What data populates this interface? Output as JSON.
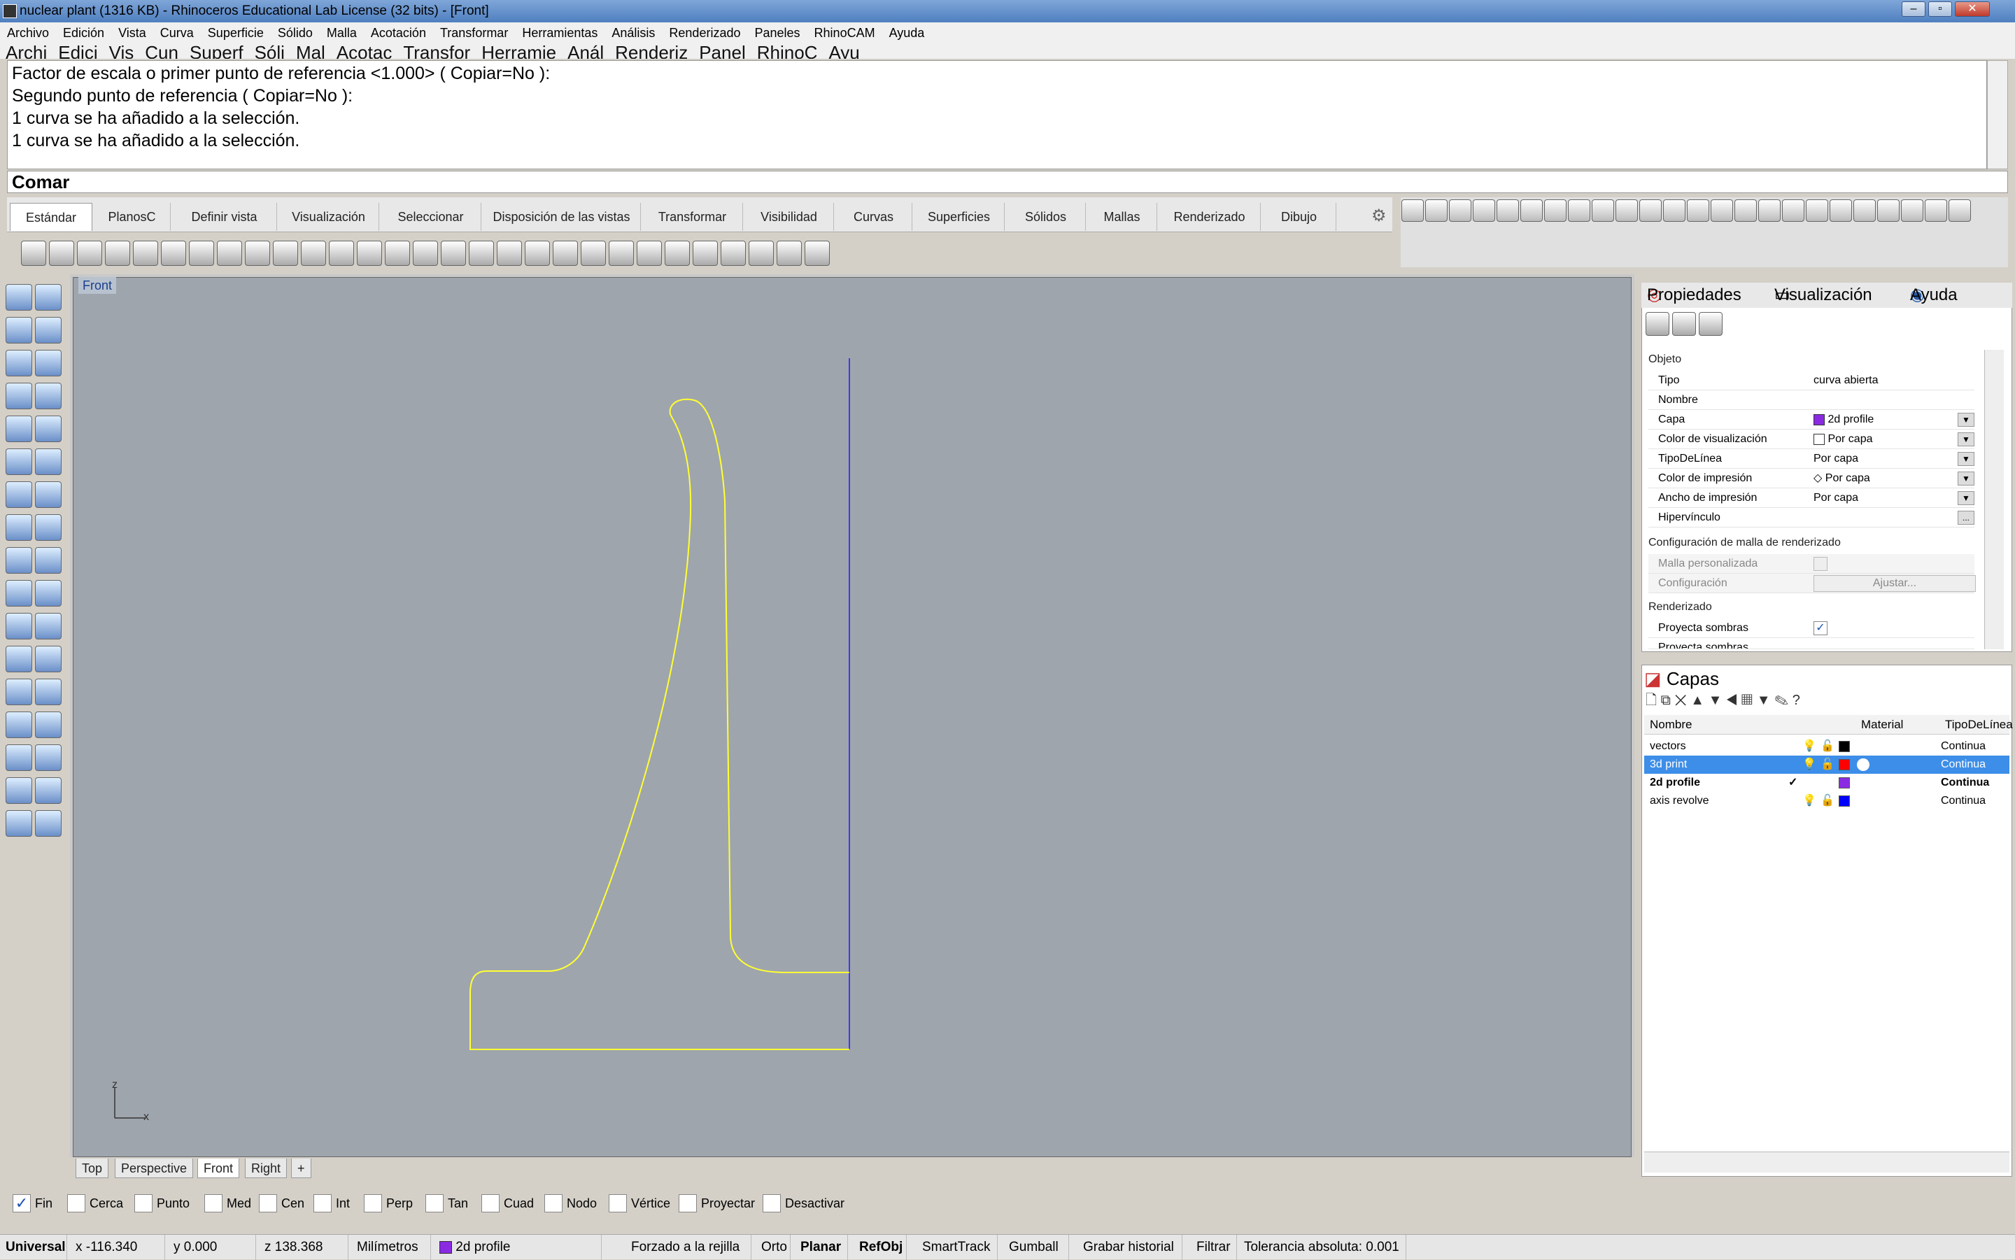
{
  "window": {
    "title": "nuclear plant (1316 KB) - Rhinoceros Educational Lab License (32 bits) - [Front]",
    "btn_min": "–",
    "btn_max": "▫",
    "btn_close": "✕"
  },
  "menu": [
    "Archivo",
    "Edición",
    "Vista",
    "Curva",
    "Superficie",
    "Sólido",
    "Malla",
    "Acotación",
    "Transformar",
    "Herramientas",
    "Análisis",
    "Renderizado",
    "Paneles",
    "RhinoCAM",
    "Ayuda"
  ],
  "menu_truncated": [
    "Archi",
    "Edici",
    "Vis",
    "Cun",
    "Superf",
    "Sóli",
    "Mal",
    "Acotac",
    "Transfor",
    "Herramie",
    "Anál",
    "Renderiz",
    "Panel",
    "RhinoC",
    "Ayu"
  ],
  "command": {
    "history": [
      "Factor de escala o primer punto de referencia <1.000> ( Copiar=No ):",
      "Segundo punto de referencia ( Copiar=No ):",
      "1 curva se ha añadido a la selección.",
      "1 curva se ha añadido a la selección."
    ],
    "prompt": "Comar"
  },
  "toolbar_tabs": [
    "Estándar",
    "PlanosC",
    "Definir vista",
    "Visualización",
    "Seleccionar",
    "Disposición de las vistas",
    "Transformar",
    "Visibilidad",
    "Curvas",
    "Superficies",
    "Sólidos",
    "Mallas",
    "Renderizado",
    "Dibujo"
  ],
  "viewport": {
    "name": "Front",
    "axis_z": "z",
    "axis_x": "x",
    "curve_color": "#ffff33",
    "axis_color": "#3a3aff"
  },
  "viewport_tabs": [
    "Top",
    "Perspective",
    "Front",
    "Right"
  ],
  "viewport_tab_add": "+",
  "osnaps": [
    {
      "label": "Fin",
      "checked": "✓"
    },
    {
      "label": "Cerca",
      "checked": ""
    },
    {
      "label": "Punto",
      "checked": ""
    },
    {
      "label": "Med",
      "checked": ""
    },
    {
      "label": "Cen",
      "checked": ""
    },
    {
      "label": "Int",
      "checked": ""
    },
    {
      "label": "Perp",
      "checked": ""
    },
    {
      "label": "Tan",
      "checked": ""
    },
    {
      "label": "Cuad",
      "checked": ""
    },
    {
      "label": "Nodo",
      "checked": ""
    },
    {
      "label": "Vértice",
      "checked": ""
    },
    {
      "label": "Proyectar",
      "checked": ""
    },
    {
      "label": "Desactivar",
      "checked": ""
    }
  ],
  "status": {
    "cplane": "Universal",
    "x": "x -116.340",
    "y": "y 0.000",
    "z": "z 138.368",
    "units": "Milímetros",
    "layer": "2d profile",
    "grid_snap": "Forzado a la rejilla",
    "ortho": "Orto",
    "planar": "Planar",
    "refobj": "RefObj",
    "smarttrack": "SmartTrack",
    "gumball": "Gumball",
    "history": "Grabar historial",
    "filter": "Filtrar",
    "tolerance": "Tolerancia absoluta: 0.001"
  },
  "properties": {
    "tabs": [
      "Propiedades",
      "Visualización",
      "Ayuda"
    ],
    "section_object": "Objeto",
    "rows": [
      {
        "k": "Tipo",
        "v": "curva abierta"
      },
      {
        "k": "Nombre",
        "v": ""
      },
      {
        "k": "Capa",
        "v": "2d profile"
      },
      {
        "k": "Color de visualización",
        "v": "Por capa"
      },
      {
        "k": "TipoDeLínea",
        "v": "Por capa"
      },
      {
        "k": "Color de impresión",
        "v": "Por capa"
      },
      {
        "k": "Ancho de impresión",
        "v": "Por capa"
      },
      {
        "k": "Hipervínculo",
        "v": ""
      }
    ],
    "section_mesh": "Configuración de malla de renderizado",
    "mesh_custom": "Malla personalizada",
    "mesh_config": "Configuración",
    "adjust_btn": "Ajustar...",
    "section_render": "Renderizado",
    "cast_shadows": "Proyecta sombras",
    "cast_shadows2": "Proyecta sombras",
    "hyperlink_btn": "...",
    "dropdown_arrow": "▼",
    "check": "✓"
  },
  "layers": {
    "title": "Capas",
    "columns": [
      "Nombre",
      "Material",
      "TipoDeLínea"
    ],
    "rows": [
      {
        "name": "vectors",
        "color": "#000000",
        "linetype": "Continua",
        "current": ""
      },
      {
        "name": "3d print",
        "color": "#ff0000",
        "linetype": "Continua",
        "current": ""
      },
      {
        "name": "2d profile",
        "color": "#8a2be2",
        "linetype": "Continua",
        "current": "✓"
      },
      {
        "name": "axis revolve",
        "color": "#0000ff",
        "linetype": "Continua",
        "current": ""
      }
    ],
    "tools": "🗋 ⧉ ✕ ▲ ▼ ◀ ▦ ▼ ✎ ?"
  }
}
